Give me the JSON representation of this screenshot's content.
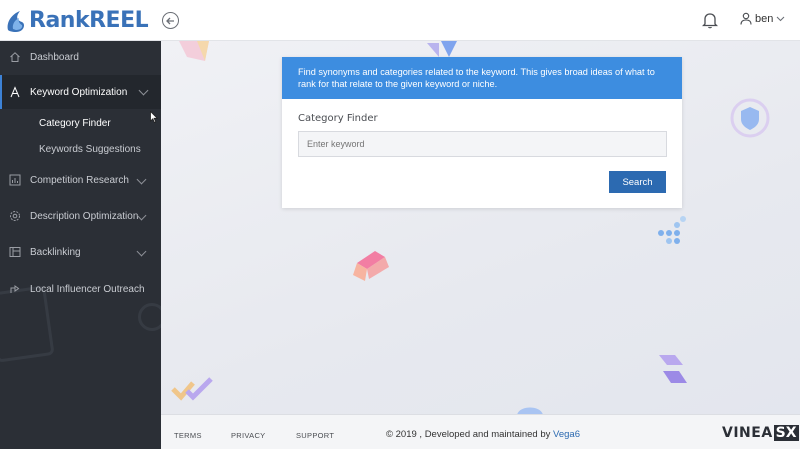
{
  "header": {
    "logo_part1": "Rank",
    "logo_part2": "REEL",
    "username": "ben",
    "icons": [
      "back-arrow-icon",
      "bell-icon",
      "user-icon",
      "chevron-down-icon"
    ]
  },
  "sidebar": {
    "items": [
      {
        "label": "Dashboard",
        "icon": "home-icon"
      },
      {
        "label": "Keyword Optimization",
        "icon": "text-icon"
      },
      {
        "label": "Competition Research",
        "icon": "chart-icon"
      },
      {
        "label": "Description Optimization",
        "icon": "gear-icon"
      },
      {
        "label": "Backlinking",
        "icon": "link-icon"
      },
      {
        "label": "Local Influencer Outreach",
        "icon": "share-icon"
      }
    ],
    "subitems": [
      {
        "label": "Category Finder"
      },
      {
        "label": "Keywords Suggestions"
      }
    ]
  },
  "card": {
    "description": "Find synonyms and categories related to the keyword. This gives broad ideas of what to rank for that relate to the given keyword or niche.",
    "field_label": "Category Finder",
    "input_placeholder": "Enter keyword",
    "input_value": "",
    "button_label": "Search"
  },
  "footer": {
    "links": [
      "TERMS",
      "PRIVACY",
      "SUPPORT"
    ],
    "copyright": "© 2019 , Developed and maintained by ",
    "developer": "Vega6",
    "brand_text": "VINEA",
    "brand_box": "SX"
  },
  "colors": {
    "sidebar_bg": "#2b2f36",
    "accent_blue": "#3d8de0",
    "button_blue": "#2c6ab1",
    "logo_blue": "#3a72b8"
  }
}
